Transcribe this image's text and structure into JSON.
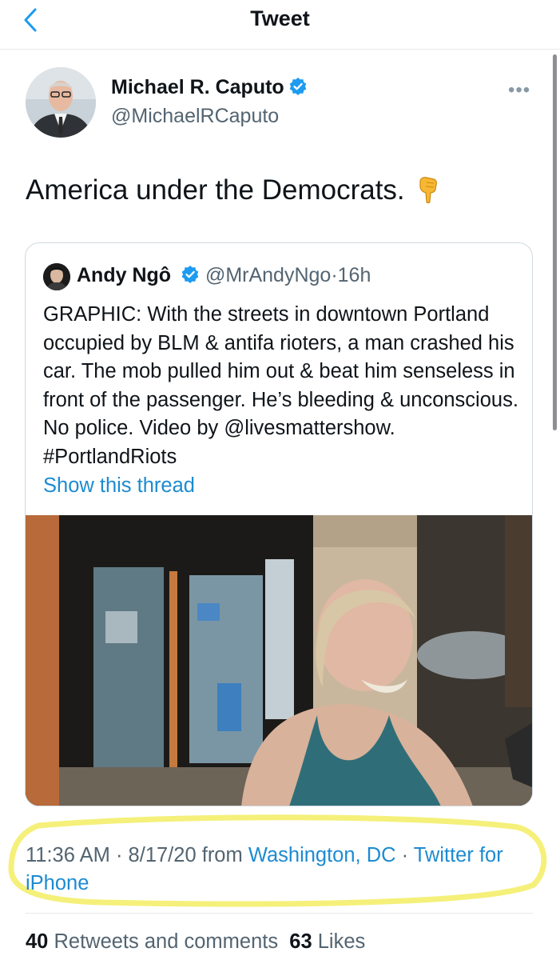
{
  "header": {
    "title": "Tweet",
    "back_icon": "chevron-left-icon"
  },
  "tweet": {
    "author_name": "Michael R. Caputo",
    "author_handle": "@MichaelRCaputo",
    "verified": true,
    "text": "America under the Democrats.",
    "emoji": "👇",
    "more_icon": "more-dots-icon"
  },
  "quote": {
    "author_name": "Andy Ngô",
    "author_handle": "@MrAndyNgo",
    "separator": "·",
    "time": "16h",
    "text": "GRAPHIC: With the streets in downtown Portland occupied by BLM & antifa rioters, a man crashed his car. The mob pulled him out & beat him senseless in front of the passenger. He’s bleeding & unconscious. No police. Video by @livesmattershow. #PortlandRiots",
    "show_thread": "Show this thread"
  },
  "meta": {
    "time": "11:36 AM",
    "dot": "·",
    "date": "8/17/20",
    "from": "from",
    "location": "Washington, DC",
    "source": "Twitter for iPhone"
  },
  "stats": {
    "retweets_count": "40",
    "retweets_label": "Retweets and comments",
    "likes_count": "63",
    "likes_label": "Likes"
  },
  "colors": {
    "link": "#1d8bd1",
    "verified": "#1d9bf0",
    "highlight": "#f5f07a"
  }
}
